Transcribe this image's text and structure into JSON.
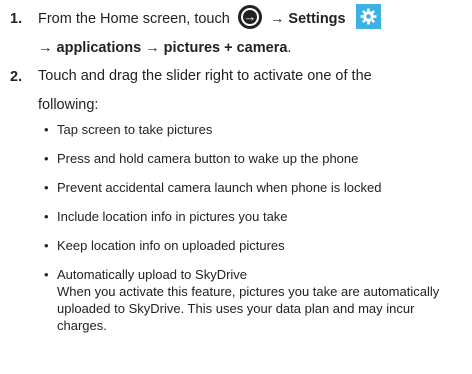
{
  "steps": [
    {
      "number": "1.",
      "line1_prefix": "From the Home screen, touch",
      "arrow_sep1": "→",
      "settings_label": "Settings",
      "line2": "→ applications → pictures + camera",
      "line2_end": "."
    },
    {
      "number": "2.",
      "text_line1": "Touch and drag the slider right to activate one of the",
      "text_line2": "following:"
    }
  ],
  "bullets": [
    {
      "text": "Tap screen to take pictures"
    },
    {
      "text": "Press and hold camera button to wake up the phone"
    },
    {
      "text": "Prevent accidental camera launch when phone is locked"
    },
    {
      "text": "Include location info in pictures you take"
    },
    {
      "text": "Keep location info on uploaded pictures"
    },
    {
      "text": "Automatically upload to SkyDrive",
      "subtext": "When you activate this feature, pictures you take are automatically uploaded to SkyDrive. This uses your data plan and may incur charges."
    }
  ],
  "bullet_char": "•",
  "icons": {
    "start_icon": "arrow-circle-right-icon",
    "settings_icon": "gear-icon"
  },
  "colors": {
    "settings_tile": "#3db1e4",
    "text": "#222222"
  }
}
